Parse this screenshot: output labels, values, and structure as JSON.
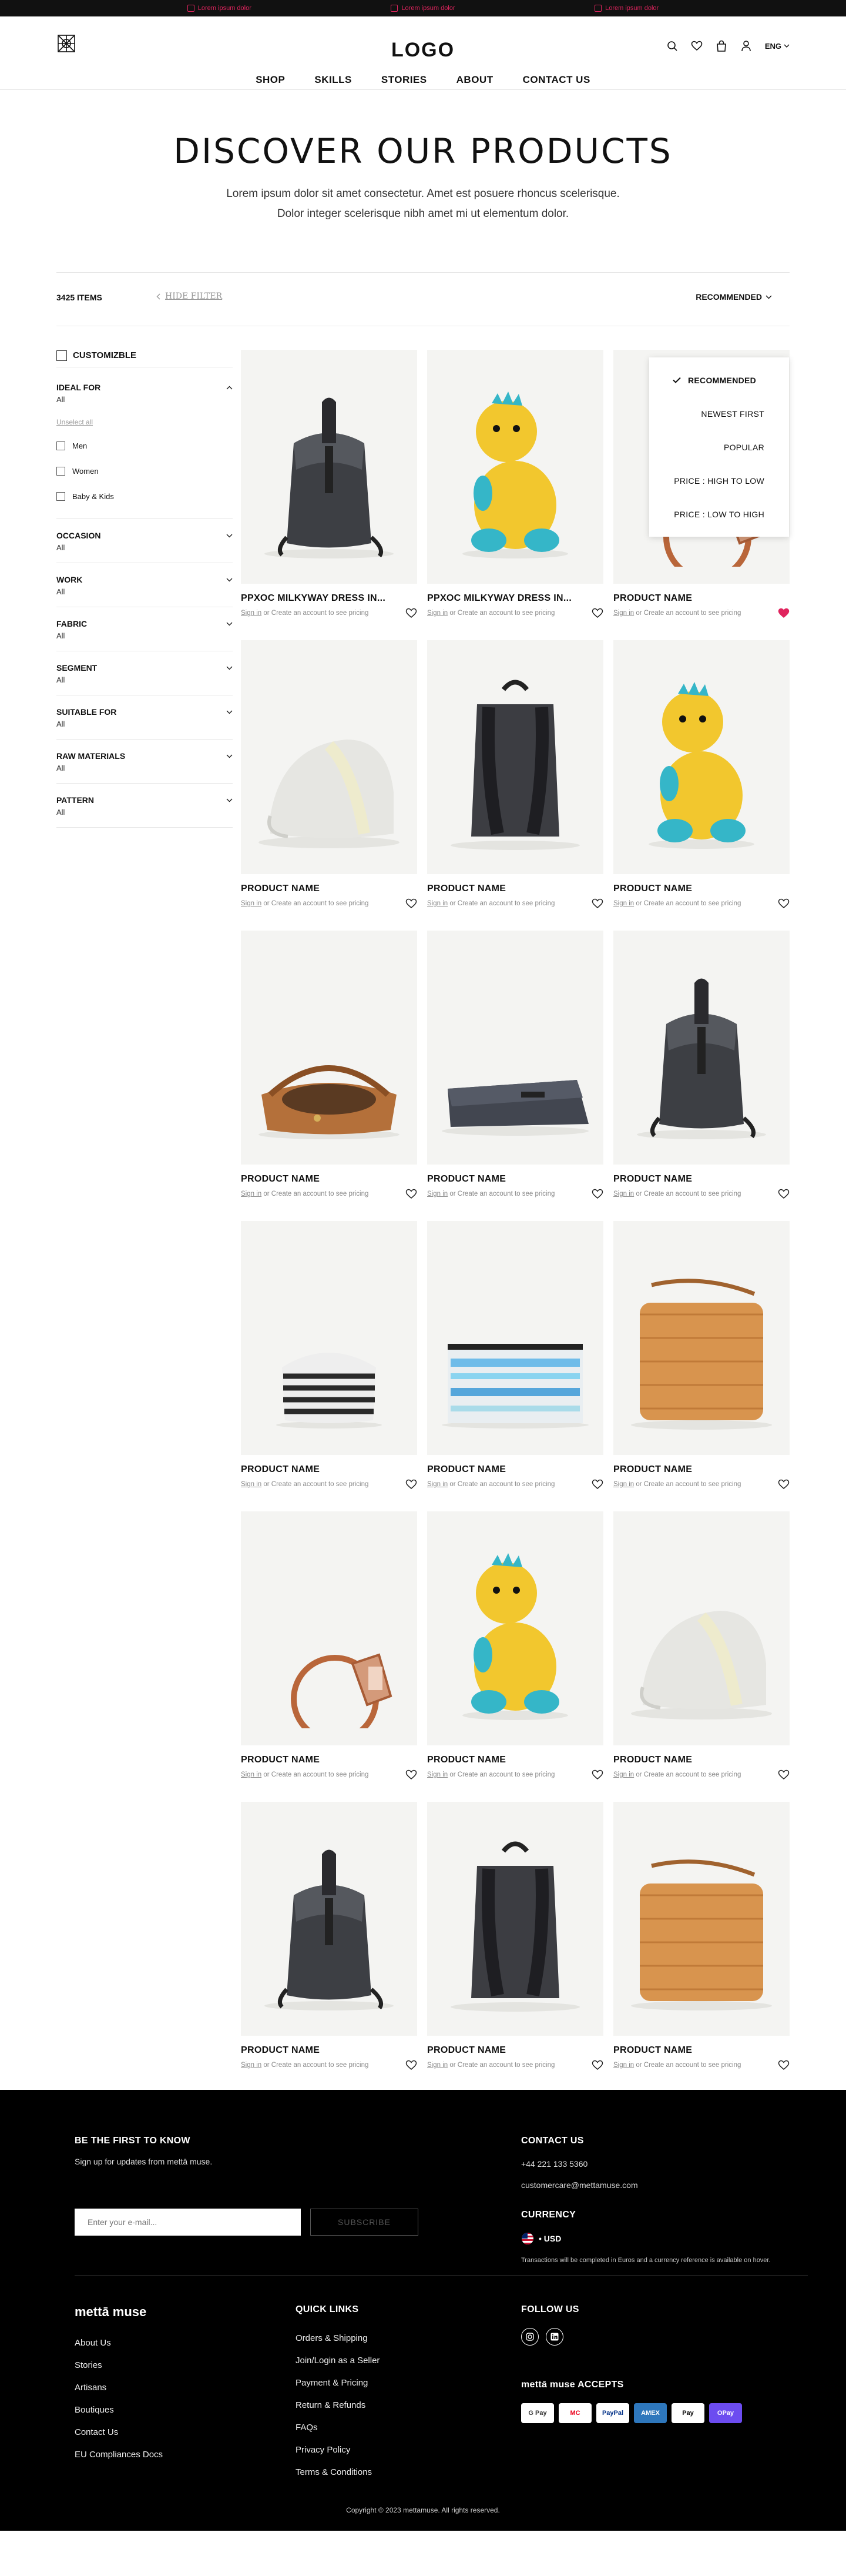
{
  "promo": [
    "Lorem ipsum dolor",
    "Lorem ipsum dolor",
    "Lorem ipsum dolor"
  ],
  "header": {
    "logo": "LOGO",
    "lang": "ENG",
    "nav": [
      "SHOP",
      "SKILLS",
      "STORIES",
      "ABOUT",
      "CONTACT US"
    ]
  },
  "hero": {
    "title": "DISCOVER OUR PRODUCTS",
    "text": "Lorem ipsum dolor sit amet consectetur. Amet est posuere rhoncus scelerisque. Dolor integer scelerisque nibh amet mi ut elementum dolor."
  },
  "toolbar": {
    "items": "3425 ITEMS",
    "hide_filter": "HIDE FILTER",
    "sort_label": "RECOMMENDED"
  },
  "sort_options": [
    "RECOMMENDED",
    "NEWEST FIRST",
    "POPULAR",
    "PRICE : HIGH TO LOW",
    "PRICE : LOW TO HIGH"
  ],
  "filters": {
    "customizable": "CUSTOMIZBLE",
    "ideal_for": {
      "title": "IDEAL FOR",
      "value": "All",
      "unselect": "Unselect all",
      "options": [
        "Men",
        "Women",
        "Baby & Kids"
      ]
    },
    "groups": [
      {
        "title": "OCCASION",
        "value": "All"
      },
      {
        "title": "WORK",
        "value": "All"
      },
      {
        "title": "FABRIC",
        "value": "All"
      },
      {
        "title": "SEGMENT",
        "value": "All"
      },
      {
        "title": "SUITABLE FOR",
        "value": "All"
      },
      {
        "title": "RAW MATERIALS",
        "value": "All"
      },
      {
        "title": "PATTERN",
        "value": "All"
      }
    ]
  },
  "product_msg": {
    "signin": "Sign in",
    "rest": " or Create an account to see pricing"
  },
  "products": [
    {
      "name": "PPXOC MILKYWAY DRESS IN...",
      "kind": "backpack-roll",
      "fav": false
    },
    {
      "name": "PPXOC MILKYWAY DRESS IN...",
      "kind": "dino",
      "fav": false
    },
    {
      "name": "PRODUCT NAME",
      "kind": "tag",
      "fav": true
    },
    {
      "name": "PRODUCT NAME",
      "kind": "cap",
      "fav": false
    },
    {
      "name": "PRODUCT NAME",
      "kind": "backpack-back",
      "fav": false
    },
    {
      "name": "PRODUCT NAME",
      "kind": "dino",
      "fav": false
    },
    {
      "name": "PRODUCT NAME",
      "kind": "bag-brown",
      "fav": false
    },
    {
      "name": "PRODUCT NAME",
      "kind": "clutch",
      "fav": false
    },
    {
      "name": "PRODUCT NAME",
      "kind": "backpack-roll",
      "fav": false
    },
    {
      "name": "PRODUCT NAME",
      "kind": "pouch-stripe",
      "fav": false
    },
    {
      "name": "PRODUCT NAME",
      "kind": "pouch-blue",
      "fav": false
    },
    {
      "name": "PRODUCT NAME",
      "kind": "bag-woven",
      "fav": false
    },
    {
      "name": "PRODUCT NAME",
      "kind": "tag",
      "fav": false
    },
    {
      "name": "PRODUCT NAME",
      "kind": "dino",
      "fav": false
    },
    {
      "name": "PRODUCT NAME",
      "kind": "cap",
      "fav": false
    },
    {
      "name": "PRODUCT NAME",
      "kind": "backpack-roll",
      "fav": false
    },
    {
      "name": "PRODUCT NAME",
      "kind": "backpack-back",
      "fav": false
    },
    {
      "name": "PRODUCT NAME",
      "kind": "bag-woven",
      "fav": false
    }
  ],
  "footer": {
    "newsletter_title": "BE THE FIRST TO KNOW",
    "newsletter_text": "Sign up for updates from mettā muse.",
    "email_placeholder": "Enter your e-mail...",
    "subscribe": "SUBSCRIBE",
    "contact_title": "CONTACT US",
    "phone": "+44 221 133 5360",
    "email": "customercare@mettamuse.com",
    "currency_title": "CURRENCY",
    "currency": "• USD",
    "currency_note": "Transactions will be completed in Euros and a currency reference is available on hover.",
    "brand": "mettā muse",
    "brand_links": [
      "About Us",
      "Stories",
      "Artisans",
      "Boutiques",
      "Contact Us",
      "EU Compliances Docs"
    ],
    "quick_title": "QUICK LINKS",
    "quick_links": [
      "Orders & Shipping",
      "Join/Login as a Seller",
      "Payment & Pricing",
      "Return & Refunds",
      "FAQs",
      "Privacy Policy",
      "Terms & Conditions"
    ],
    "follow_title": "FOLLOW US",
    "accepts_title": "mettā muse ACCEPTS",
    "payments": [
      "G Pay",
      "MC",
      "PayPal",
      "AMEX",
      "Pay",
      "OPay"
    ],
    "copyright": "Copyright © 2023 mettamuse. All rights reserved."
  }
}
